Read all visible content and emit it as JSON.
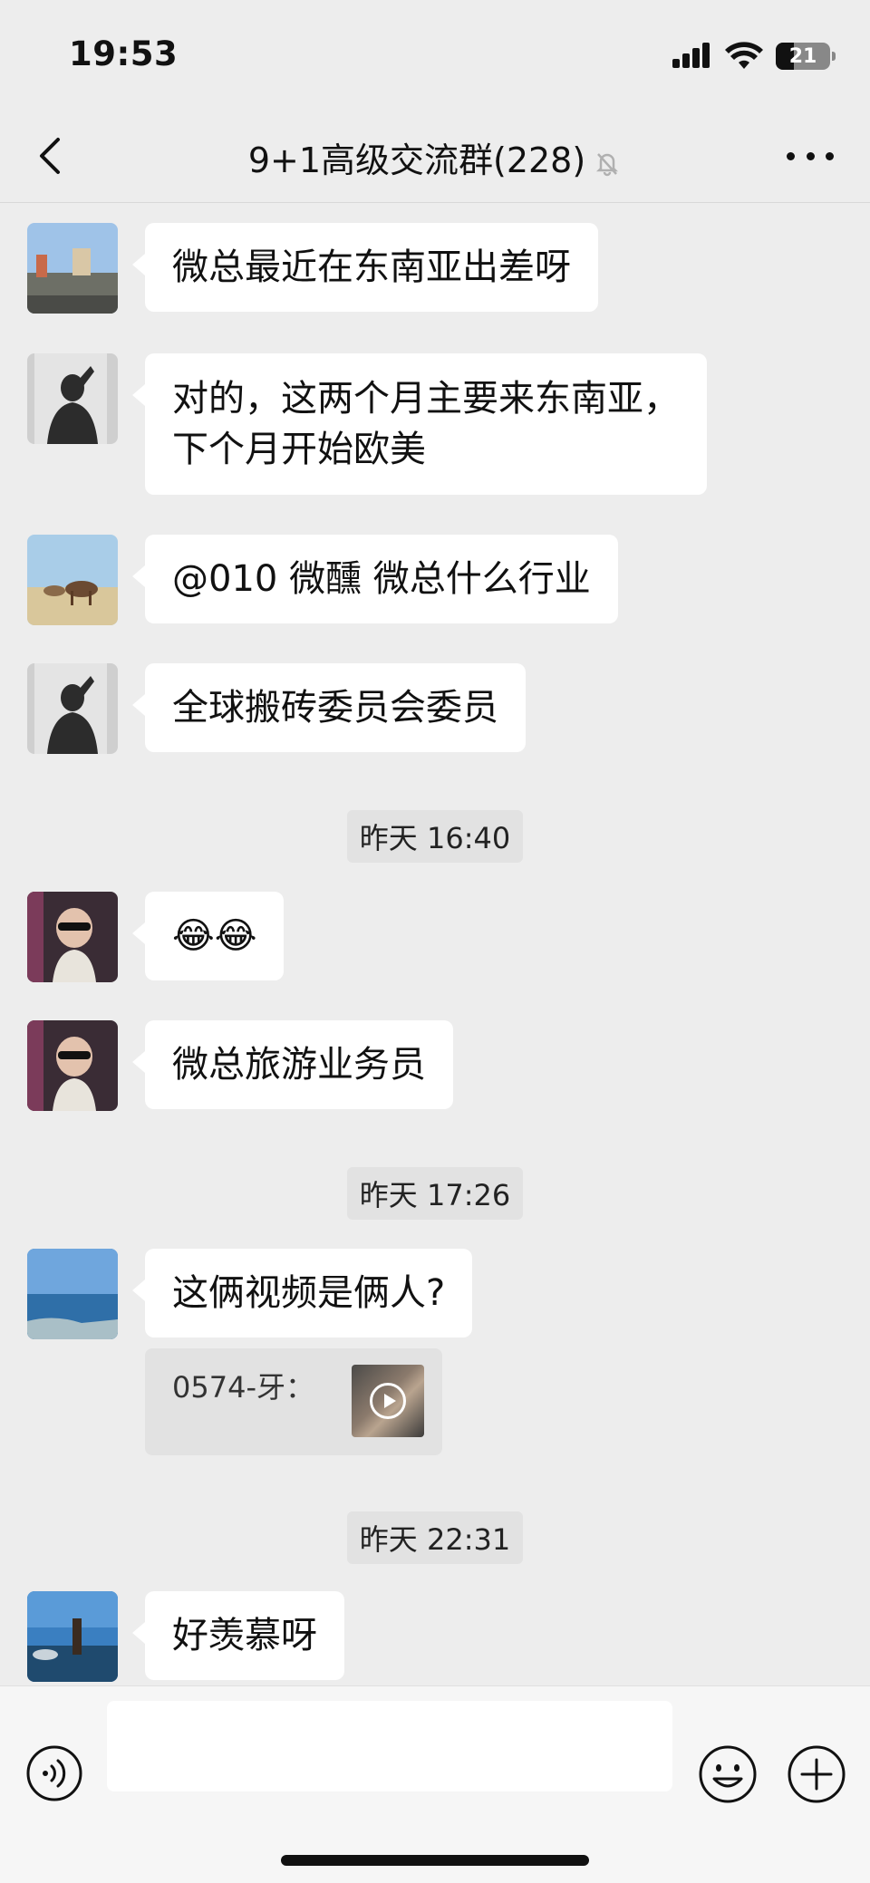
{
  "status_bar": {
    "time": "19:53",
    "battery": "21"
  },
  "header": {
    "title": "9+1高级交流群(228)"
  },
  "messages": [
    {
      "type": "text",
      "avatar": "avatar-street-scene",
      "text": "微总最近在东南亚出差呀"
    },
    {
      "type": "text",
      "avatar": "avatar-dark-silhouette",
      "lines": [
        "对的，这两个月主要来东南亚，",
        "下个月开始欧美"
      ]
    },
    {
      "type": "text",
      "avatar": "avatar-horses",
      "text": "@010 微醺 微总什么行业"
    },
    {
      "type": "text",
      "avatar": "avatar-dark-silhouette",
      "text": "全球搬砖委员会委员"
    },
    {
      "type": "timestamp",
      "text": "昨天 16:40"
    },
    {
      "type": "text",
      "avatar": "avatar-child-sunglasses",
      "text": "😂😂"
    },
    {
      "type": "text",
      "avatar": "avatar-child-sunglasses",
      "text": "微总旅游业务员"
    },
    {
      "type": "timestamp",
      "text": "昨天 17:26"
    },
    {
      "type": "text",
      "avatar": "avatar-sea-view",
      "text": "这俩视频是俩人?",
      "quote": {
        "sender": "0574-牙：",
        "kind": "video"
      }
    },
    {
      "type": "timestamp",
      "text": "昨天 22:31"
    },
    {
      "type": "text",
      "avatar": "avatar-beach-person",
      "text": "好羡慕呀"
    }
  ],
  "input_bar": {
    "placeholder": ""
  },
  "colors": {
    "background": "#ededed",
    "bubble": "#ffffff",
    "timestamp_bg": "#e2e2e2"
  }
}
